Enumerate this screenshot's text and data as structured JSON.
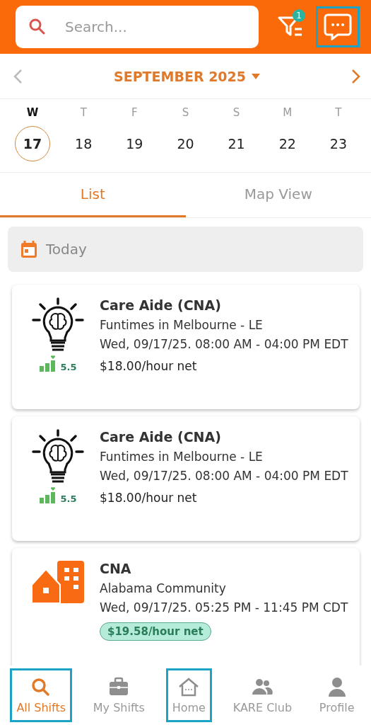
{
  "header": {
    "search": {
      "placeholder": "Search..."
    },
    "filter_badge": "1",
    "chat_highlighted": true
  },
  "calendar": {
    "month": "SEPTEMBER 2025",
    "days": [
      {
        "weekday": "W",
        "date": "17",
        "selected": true
      },
      {
        "weekday": "T",
        "date": "18",
        "selected": false
      },
      {
        "weekday": "F",
        "date": "19",
        "selected": false
      },
      {
        "weekday": "S",
        "date": "20",
        "selected": false
      },
      {
        "weekday": "S",
        "date": "21",
        "selected": false
      },
      {
        "weekday": "M",
        "date": "22",
        "selected": false
      },
      {
        "weekday": "T",
        "date": "23",
        "selected": false
      }
    ]
  },
  "tabs": [
    {
      "label": "List",
      "selected": true
    },
    {
      "label": "Map View",
      "selected": false
    }
  ],
  "section": {
    "label": "Today"
  },
  "shifts": [
    {
      "kind": "bulb",
      "title": "Care Aide (CNA)",
      "facility": "Funtimes in Melbourne - LE",
      "time": "Wed, 09/17/25. 08:00 AM - 04:00 PM EDT",
      "rating": "5.5",
      "pay": "$18.00/hour net",
      "pay_highlighted": false
    },
    {
      "kind": "bulb",
      "title": "Care Aide (CNA)",
      "facility": "Funtimes in Melbourne - LE",
      "time": "Wed, 09/17/25. 08:00 AM - 04:00 PM EDT",
      "rating": "5.5",
      "pay": "$18.00/hour net",
      "pay_highlighted": false
    },
    {
      "kind": "building",
      "title": "CNA",
      "facility": "Alabama Community",
      "time": "Wed, 09/17/25. 05:25 PM - 11:45 PM CDT",
      "pay": "$19.58/hour net",
      "pay_highlighted": true
    }
  ],
  "nav": [
    {
      "kind": "search",
      "label": "All Shifts",
      "selected": true,
      "highlighted": true
    },
    {
      "kind": "briefcase",
      "label": "My Shifts",
      "selected": false,
      "highlighted": false
    },
    {
      "kind": "home",
      "label": "Home",
      "selected": false,
      "highlighted": true
    },
    {
      "kind": "people",
      "label": "KARE Club",
      "selected": false,
      "highlighted": false
    },
    {
      "kind": "person",
      "label": "Profile",
      "selected": false,
      "highlighted": false
    }
  ]
}
